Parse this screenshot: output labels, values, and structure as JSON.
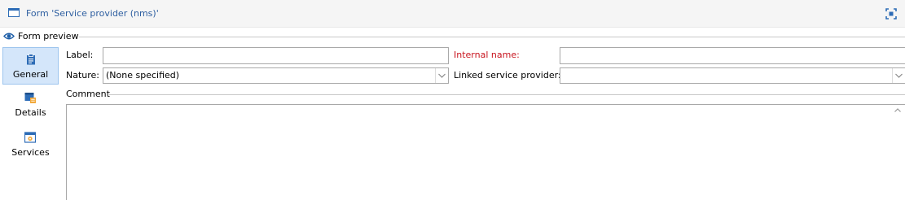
{
  "window": {
    "title": "Form 'Service provider (nms)'",
    "icon": "form-window-icon",
    "maximize_icon": "maximize-icon"
  },
  "preview": {
    "label": "Form preview",
    "icon": "eye-icon"
  },
  "tabs": [
    {
      "label": "General",
      "icon": "clipboard-icon",
      "active": true
    },
    {
      "label": "Details",
      "icon": "details-card-icon",
      "active": false
    },
    {
      "label": "Services",
      "icon": "services-window-icon",
      "active": false
    }
  ],
  "form": {
    "label_label": "Label:",
    "label_value": "",
    "internal_name_label": "Internal name:",
    "internal_name_value": "",
    "nature_label": "Nature:",
    "nature_value": "(None specified)",
    "linked_label": "Linked service provider:",
    "linked_value": "",
    "comment_label": "Comment",
    "comment_value": ""
  },
  "colors": {
    "accent": "#2d6cb6",
    "title_text": "#2d5ea0",
    "required_label": "#c8141e",
    "active_tab_bg": "#d4e6fa",
    "active_tab_border": "#9cc4ee"
  }
}
